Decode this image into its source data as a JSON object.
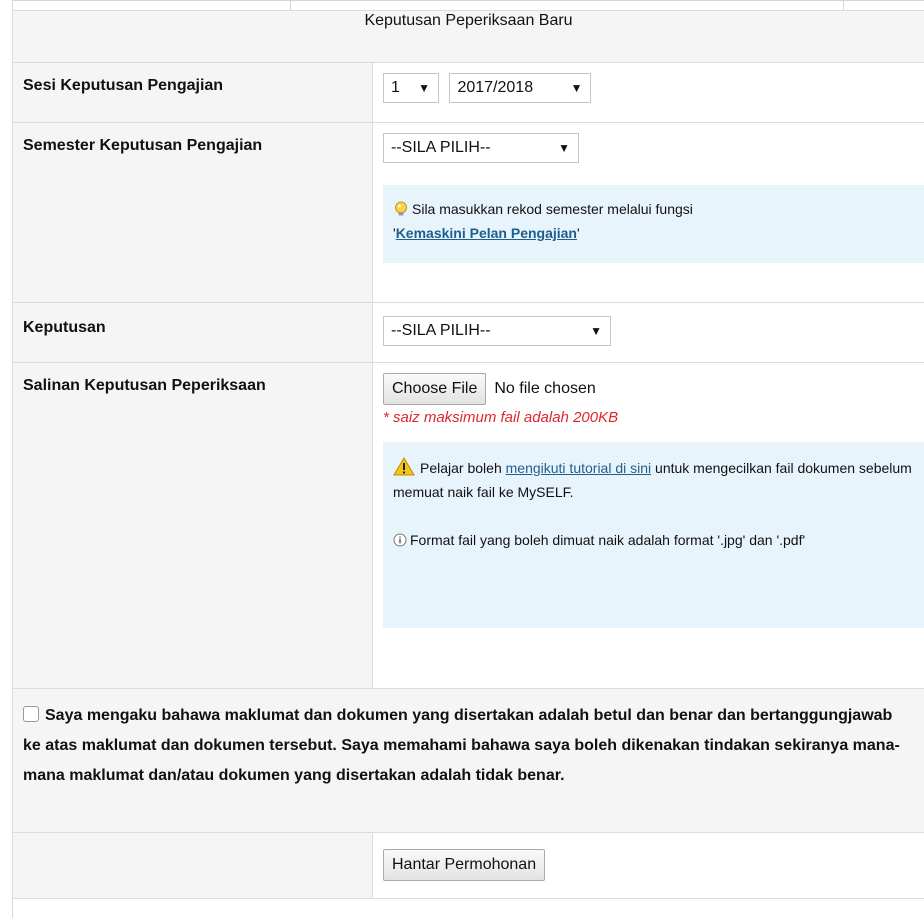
{
  "form": {
    "title": "Keputusan Peperiksaan Baru",
    "sesi": {
      "label": "Sesi Keputusan Pengajian",
      "part_value": "1",
      "year_value": "2017/2018"
    },
    "semester": {
      "label": "Semester Keputusan Pengajian",
      "value": "--SILA PILIH--",
      "hint_text": "Sila masukkan rekod semester melalui fungsi",
      "hint_quote_open": "'",
      "hint_link": "Kemaskini Pelan Pengajian",
      "hint_quote_close": "'"
    },
    "keputusan": {
      "label": "Keputusan",
      "value": "--SILA PILIH--"
    },
    "salinan": {
      "label": "Salinan Keputusan Peperiksaan",
      "choose_button": "Choose File",
      "file_status": "No file chosen",
      "size_note": "* saiz maksimum fail adalah 200KB",
      "tip_before": "Pelajar boleh ",
      "tip_link": "mengikuti tutorial di sini",
      "tip_after": " untuk mengecilkan fail dokumen sebelum memuat naik fail ke MySELF.",
      "format_note": "Format fail yang boleh dimuat naik adalah format '.jpg' dan '.pdf'"
    },
    "declaration": "Saya mengaku bahawa maklumat dan dokumen yang disertakan adalah betul dan benar dan bertanggungjawab ke atas maklumat dan dokumen tersebut. Saya memahami bahawa saya boleh dikenakan tindakan sekiranya mana-mana maklumat dan/atau dokumen yang disertakan adalah tidak benar.",
    "submit_button": "Hantar Permohonan",
    "dropdown_arrow": "▼"
  },
  "colors": {
    "label_bg": "#f5f5f5",
    "info_bg": "#e8f4fb",
    "link": "#1f5f8b",
    "error": "#e0262c"
  }
}
